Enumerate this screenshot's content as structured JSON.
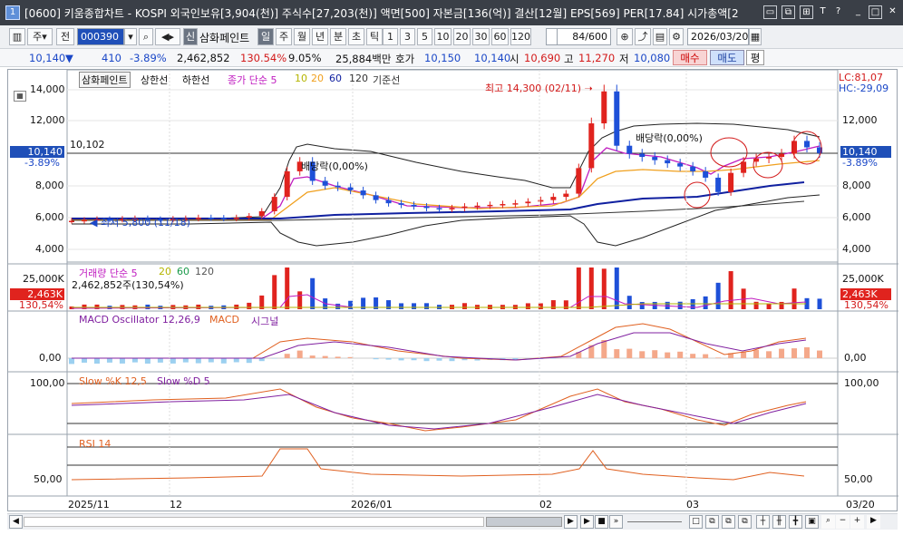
{
  "window": {
    "number": "1",
    "title": "[0600] 키움종합차트 - KOSPI 외국인보유[3,904(천)] 주식수[27,203(천)] 액면[500] 자본금[136(억)] 결산[12월] EPS[569] PER[17.84] 시가총액[2"
  },
  "toolbar": {
    "period_weekly": "주",
    "period_all": "전",
    "code": "000390",
    "flag": "신",
    "stock_name": "삼화페인트",
    "periods": [
      "일",
      "주",
      "월",
      "년",
      "분",
      "초",
      "틱"
    ],
    "intervals": [
      "1",
      "3",
      "5",
      "10",
      "20",
      "30",
      "60",
      "120"
    ],
    "count": "84",
    "count_total": "/600",
    "date": "2026/03/20"
  },
  "quote": {
    "price": "10,140",
    "arrow": "▼",
    "change": "410",
    "rate": "-3.89%",
    "volume": "2,462,852",
    "vol_ratio": "130.54%",
    "turnover": "9.05%",
    "amount": "25,884백만",
    "bid_ask_label": "호가",
    "ask": "10,150",
    "bid": "10,140",
    "open_label": "시",
    "open": "10,690",
    "high_label": "고",
    "high": "11,270",
    "low_label": "저",
    "low": "10,080",
    "buy": "매수",
    "sell": "매도",
    "eval": "평"
  },
  "price_panel": {
    "legend": {
      "name": "삼화페인트",
      "upper": "상한선",
      "lower": "하한선",
      "ma": "종가 단순 5",
      "ma10": "10",
      "ma20": "20",
      "ma60": "60",
      "ma120": "120",
      "base": "기준선"
    },
    "yaxis": [
      "14,000",
      "12,000",
      "10,000",
      "8,000",
      "6,000",
      "4,000"
    ],
    "current_label": "10,140",
    "current_rate": "-3.89%",
    "ref_line_label": "10,102",
    "lc": "LC:81,07",
    "hc": "HC:-29,09",
    "high_annot": "최고 14,300 (02/11)",
    "low_annot": "최저 5,800 (11/18)",
    "dividend1": "배당락(0,00%)",
    "dividend2": "배당락(0,00%)"
  },
  "volume_panel": {
    "legend": "거래량 단순 5",
    "l20": "20",
    "l60": "60",
    "l120": "120",
    "value_line": "2,462,852주(130,54%)",
    "axis": "25,000K",
    "current": "2,463K",
    "current_rate": "130,54%"
  },
  "macd_panel": {
    "legend": "MACD Oscillator 12,26,9",
    "macd": "MACD",
    "signal": "시그널",
    "axis": "0,00"
  },
  "stoch_panel": {
    "legend": "Slow %K 12,5",
    "d": "Slow %D 5",
    "axis": "100,00"
  },
  "rsi_panel": {
    "legend": "RSI 14",
    "axis": "50,00"
  },
  "xaxis": [
    "2025/11",
    "12",
    "2026/01",
    "02",
    "03",
    "03/20"
  ],
  "colors": {
    "up": "#e0231e",
    "down": "#1e50d8",
    "ma5": "#c01cc0",
    "ma20": "#f0a01e",
    "ma60": "#1020a0",
    "titlebar": "#3a3f47"
  },
  "chart_data": {
    "type": "candlestick",
    "xlabel": "",
    "ylabel": "",
    "approx_closes": [
      5900,
      5950,
      6000,
      5980,
      6020,
      6050,
      6000,
      5980,
      6020,
      6050,
      6100,
      6080,
      6050,
      6100,
      6200,
      6500,
      7400,
      9000,
      9600,
      8400,
      8100,
      8000,
      7800,
      7500,
      7200,
      7000,
      6900,
      6800,
      6700,
      6650,
      6700,
      6800,
      6850,
      6900,
      6950,
      7000,
      7100,
      7200,
      7400,
      7600,
      9200,
      12000,
      14000,
      10600,
      10100,
      9900,
      9700,
      9500,
      9300,
      9000,
      8600,
      7700,
      8900,
      9600,
      9800,
      9900,
      10100,
      10900,
      10500,
      10140
    ],
    "ylim": [
      4000,
      14500
    ],
    "annotations": [
      "최고 14,300 (02/11)",
      "최저 5,800 (11/18)"
    ]
  }
}
